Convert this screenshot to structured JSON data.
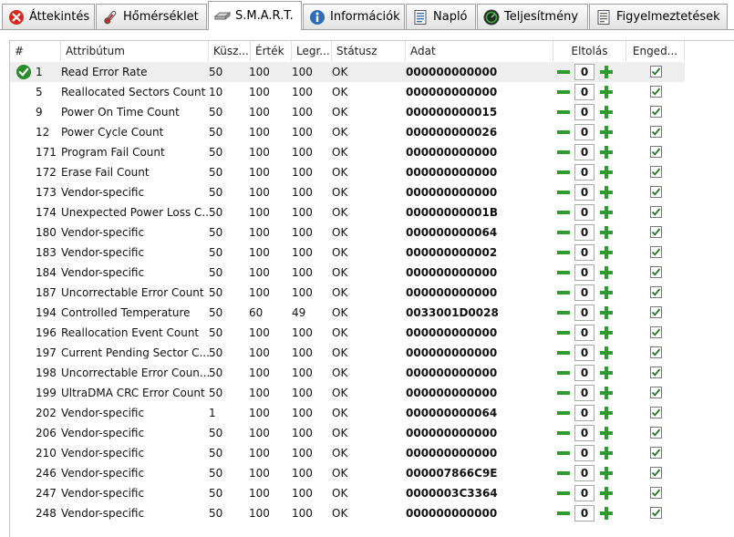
{
  "tabs": [
    {
      "label": "Áttekintés",
      "icon": "error-icon",
      "active": false
    },
    {
      "label": "Hőmérséklet",
      "icon": "thermometer-icon",
      "active": false
    },
    {
      "label": "S.M.A.R.T.",
      "icon": "hard-drive-icon",
      "active": true
    },
    {
      "label": "Információk",
      "icon": "info-icon",
      "active": false
    },
    {
      "label": "Napló",
      "icon": "log-document-icon",
      "active": false
    },
    {
      "label": "Teljesítmény",
      "icon": "gauge-icon",
      "active": false
    },
    {
      "label": "Figyelmeztetések",
      "icon": "warnings-document-icon",
      "active": false
    }
  ],
  "columns": {
    "id": "#",
    "attribute": "Attribútum",
    "threshold": "Küsz...",
    "value": "Érték",
    "worst": "Legr...",
    "status": "Státusz",
    "data": "Adat",
    "offset": "Eltolás",
    "enabled": "Enged..."
  },
  "colors": {
    "accent_green": "#2e9b2e",
    "ok_badge": "#2a8c2a",
    "selected_row": "#eeeeee",
    "error_icon": "#d9261c"
  },
  "rows": [
    {
      "id": "1",
      "name": "Read Error Rate",
      "threshold": "50",
      "value": "100",
      "worst": "100",
      "status": "OK",
      "data": "000000000000",
      "offset": "0",
      "enabled": true,
      "selected": true
    },
    {
      "id": "5",
      "name": "Reallocated Sectors Count",
      "threshold": "10",
      "value": "100",
      "worst": "100",
      "status": "OK",
      "data": "000000000000",
      "offset": "0",
      "enabled": true
    },
    {
      "id": "9",
      "name": "Power On Time Count",
      "threshold": "50",
      "value": "100",
      "worst": "100",
      "status": "OK",
      "data": "000000000015",
      "offset": "0",
      "enabled": true
    },
    {
      "id": "12",
      "name": "Power Cycle Count",
      "threshold": "50",
      "value": "100",
      "worst": "100",
      "status": "OK",
      "data": "000000000026",
      "offset": "0",
      "enabled": true
    },
    {
      "id": "171",
      "name": "Program Fail Count",
      "threshold": "50",
      "value": "100",
      "worst": "100",
      "status": "OK",
      "data": "000000000000",
      "offset": "0",
      "enabled": true
    },
    {
      "id": "172",
      "name": "Erase Fail Count",
      "threshold": "50",
      "value": "100",
      "worst": "100",
      "status": "OK",
      "data": "000000000000",
      "offset": "0",
      "enabled": true
    },
    {
      "id": "173",
      "name": "Vendor-specific",
      "threshold": "50",
      "value": "100",
      "worst": "100",
      "status": "OK",
      "data": "000000000000",
      "offset": "0",
      "enabled": true
    },
    {
      "id": "174",
      "name": "Unexpected Power Loss C...",
      "threshold": "50",
      "value": "100",
      "worst": "100",
      "status": "OK",
      "data": "00000000001B",
      "offset": "0",
      "enabled": true
    },
    {
      "id": "180",
      "name": "Vendor-specific",
      "threshold": "50",
      "value": "100",
      "worst": "100",
      "status": "OK",
      "data": "000000000064",
      "offset": "0",
      "enabled": true
    },
    {
      "id": "183",
      "name": "Vendor-specific",
      "threshold": "50",
      "value": "100",
      "worst": "100",
      "status": "OK",
      "data": "000000000002",
      "offset": "0",
      "enabled": true
    },
    {
      "id": "184",
      "name": "Vendor-specific",
      "threshold": "50",
      "value": "100",
      "worst": "100",
      "status": "OK",
      "data": "000000000000",
      "offset": "0",
      "enabled": true
    },
    {
      "id": "187",
      "name": "Uncorrectable Error Count",
      "threshold": "50",
      "value": "100",
      "worst": "100",
      "status": "OK",
      "data": "000000000000",
      "offset": "0",
      "enabled": true
    },
    {
      "id": "194",
      "name": "Controlled Temperature",
      "threshold": "50",
      "value": "60",
      "worst": "49",
      "status": "OK",
      "data": "0033001D0028",
      "offset": "0",
      "enabled": true
    },
    {
      "id": "196",
      "name": "Reallocation Event Count",
      "threshold": "50",
      "value": "100",
      "worst": "100",
      "status": "OK",
      "data": "000000000000",
      "offset": "0",
      "enabled": true
    },
    {
      "id": "197",
      "name": "Current Pending Sector C...",
      "threshold": "50",
      "value": "100",
      "worst": "100",
      "status": "OK",
      "data": "000000000000",
      "offset": "0",
      "enabled": true
    },
    {
      "id": "198",
      "name": "Uncorrectable Error Coun...",
      "threshold": "50",
      "value": "100",
      "worst": "100",
      "status": "OK",
      "data": "000000000000",
      "offset": "0",
      "enabled": true
    },
    {
      "id": "199",
      "name": "UltraDMA CRC Error Count",
      "threshold": "50",
      "value": "100",
      "worst": "100",
      "status": "OK",
      "data": "000000000000",
      "offset": "0",
      "enabled": true
    },
    {
      "id": "202",
      "name": "Vendor-specific",
      "threshold": "1",
      "value": "100",
      "worst": "100",
      "status": "OK",
      "data": "000000000064",
      "offset": "0",
      "enabled": true
    },
    {
      "id": "206",
      "name": "Vendor-specific",
      "threshold": "50",
      "value": "100",
      "worst": "100",
      "status": "OK",
      "data": "000000000000",
      "offset": "0",
      "enabled": true
    },
    {
      "id": "210",
      "name": "Vendor-specific",
      "threshold": "50",
      "value": "100",
      "worst": "100",
      "status": "OK",
      "data": "000000000000",
      "offset": "0",
      "enabled": true
    },
    {
      "id": "246",
      "name": "Vendor-specific",
      "threshold": "50",
      "value": "100",
      "worst": "100",
      "status": "OK",
      "data": "000007866C9E",
      "offset": "0",
      "enabled": true
    },
    {
      "id": "247",
      "name": "Vendor-specific",
      "threshold": "50",
      "value": "100",
      "worst": "100",
      "status": "OK",
      "data": "0000003C3364",
      "offset": "0",
      "enabled": true
    },
    {
      "id": "248",
      "name": "Vendor-specific",
      "threshold": "50",
      "value": "100",
      "worst": "100",
      "status": "OK",
      "data": "000000000000",
      "offset": "0",
      "enabled": true
    }
  ]
}
